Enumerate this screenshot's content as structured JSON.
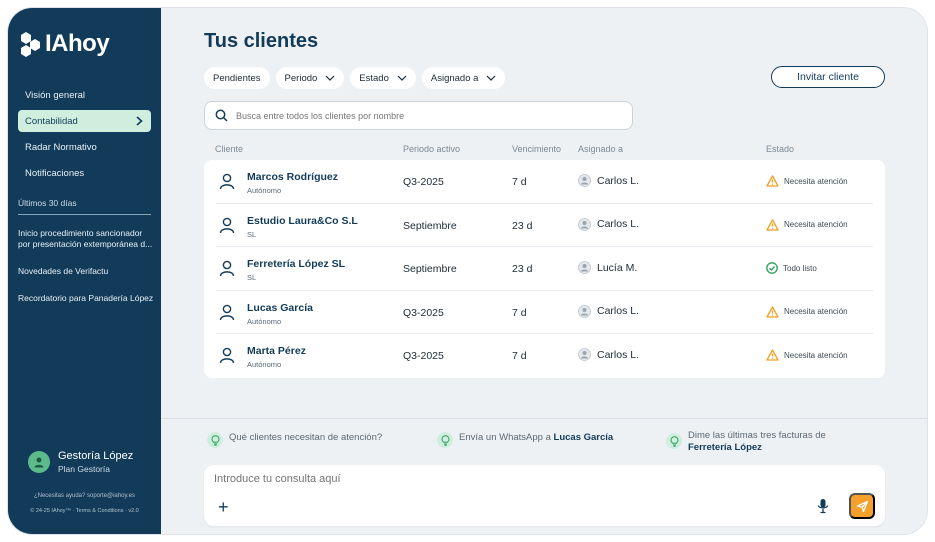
{
  "brand": {
    "name": "IAhoy"
  },
  "sidebar": {
    "nav": [
      {
        "label": "Visión general"
      },
      {
        "label": "Contabilidad"
      },
      {
        "label": "Radar Normativo"
      },
      {
        "label": "Notificaciones"
      }
    ],
    "recent_title": "Últimos 30 días",
    "recent": [
      {
        "label": "Inicio procedimiento sancionador por presentación extemporánea d..."
      },
      {
        "label": "Novedades de Verifactu"
      },
      {
        "label": "Recordatorio para Panadería López"
      }
    ],
    "profile": {
      "name": "Gestoría López",
      "plan": "Plan Gestoría"
    },
    "help_text": "¿Necesitas ayuda? soporte@iahoy.es",
    "legal_text": "© 24-25 IAhoy™ · Terms & Conditions · v2.0"
  },
  "main": {
    "title": "Tus clientes",
    "filters": [
      {
        "label": "Pendientes",
        "dropdown": false
      },
      {
        "label": "Periodo",
        "dropdown": true
      },
      {
        "label": "Estado",
        "dropdown": true
      },
      {
        "label": "Asignado a",
        "dropdown": true
      }
    ],
    "invite_label": "Invitar cliente",
    "search_placeholder": "Busca entre todos los clientes por nombre",
    "columns": {
      "client": "Cliente",
      "period": "Periodo activo",
      "due": "Vencimiento",
      "assigned": "Asignado a",
      "status": "Estado"
    },
    "rows": [
      {
        "name": "Marcos Rodríguez",
        "type": "Autónomo",
        "period": "Q3-2025",
        "due": "7 d",
        "assigned": "Carlos L.",
        "status": "Necesita atención",
        "status_kind": "warning"
      },
      {
        "name": "Estudio Laura&Co S.L",
        "type": "SL",
        "period": "Septiembre",
        "due": "23 d",
        "assigned": "Carlos L.",
        "status": "Necesita atención",
        "status_kind": "warning"
      },
      {
        "name": "Ferretería López SL",
        "type": "SL",
        "period": "Septiembre",
        "due": "23 d",
        "assigned": "Lucía M.",
        "status": "Todo listo",
        "status_kind": "ok"
      },
      {
        "name": "Lucas García",
        "type": "Autónomo",
        "period": "Q3-2025",
        "due": "7 d",
        "assigned": "Carlos L.",
        "status": "Necesita atención",
        "status_kind": "warning"
      },
      {
        "name": "Marta Pérez",
        "type": "Autónomo",
        "period": "Q3-2025",
        "due": "7 d",
        "assigned": "Carlos L.",
        "status": "Necesita atención",
        "status_kind": "warning"
      }
    ],
    "suggestions": {
      "s1": "Qué clientes necesitan de atención?",
      "s2_prefix": "Envía un WhatsApp a ",
      "s2_bold": "Lucas García",
      "s3_prefix": "Dime las últimas tres facturas de",
      "s3_bold": "Ferretería López"
    },
    "composer_placeholder": "Introduce tu consulta aquí"
  },
  "colors": {
    "sidebar": "#123b5a",
    "accent_green": "#cfeedd",
    "warning": "#f0a020",
    "ok": "#2e9e5b",
    "send": "#f5a02a"
  }
}
